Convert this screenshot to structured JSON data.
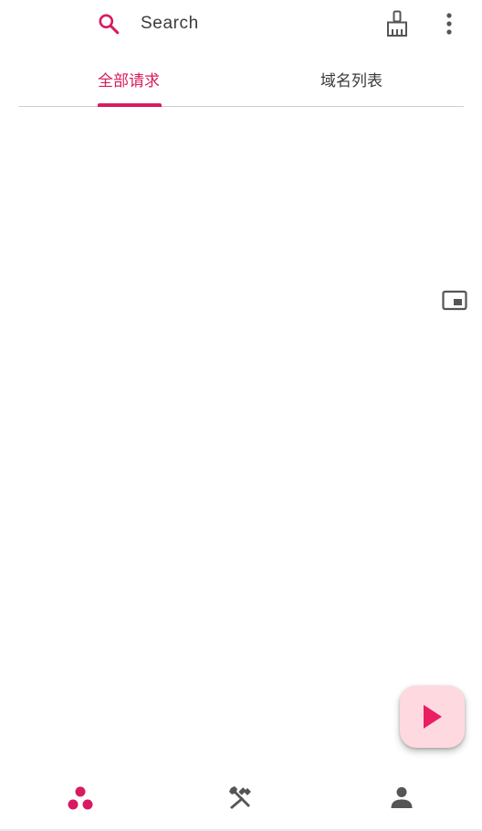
{
  "search": {
    "placeholder": "Search",
    "icon": "search-icon"
  },
  "toolbar": {
    "clean_icon": "broom-icon",
    "more_icon": "more-vert-icon"
  },
  "tabs": [
    {
      "label": "全部请求",
      "selected": true
    },
    {
      "label": "域名列表",
      "selected": false
    }
  ],
  "floating": {
    "pip_icon": "picture-in-picture-icon",
    "fab_icon": "play-icon"
  },
  "bottom_nav": [
    {
      "icon": "bubbles-icon",
      "selected": true
    },
    {
      "icon": "tools-icon",
      "selected": false
    },
    {
      "icon": "person-icon",
      "selected": false
    }
  ],
  "colors": {
    "accent": "#d81b60",
    "fab_background": "#ffd9e0",
    "icon_gray": "#555555",
    "text_dark": "#3a3a3a"
  }
}
